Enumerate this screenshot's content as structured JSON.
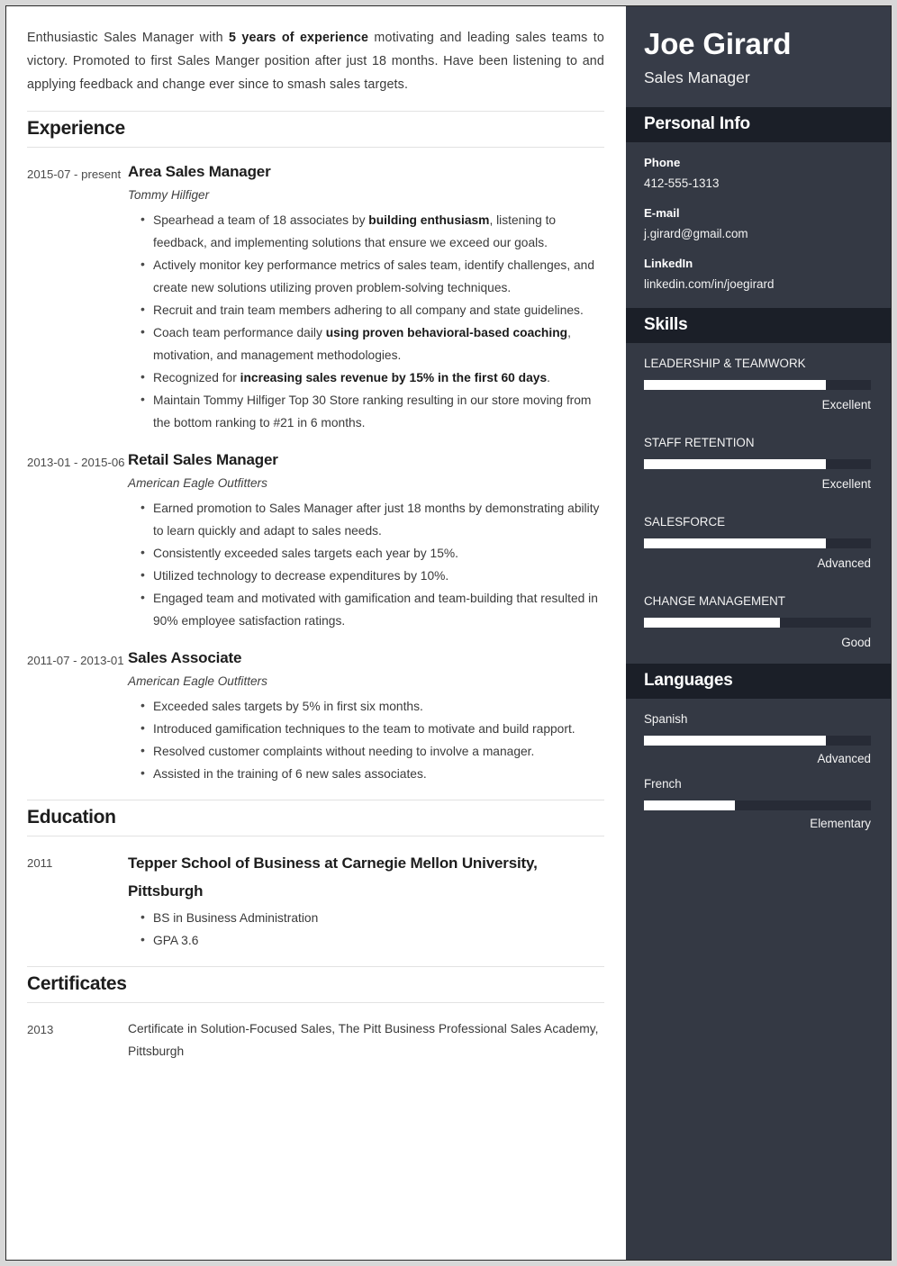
{
  "colors": {
    "sidebar_bg": "#343944",
    "sidebar_hero_bg": "#373c48",
    "section_header_bg": "#1b1f28",
    "bar_track": "#272b36",
    "bar_fill": "#ffffff",
    "page_bg": "#d8d8d8"
  },
  "summary": {
    "before_bold": "Enthusiastic Sales Manager with ",
    "bold": "5 years of experience",
    "after_bold": " motivating and leading sales teams to victory. Promoted to first Sales Manger position after just 18 months. Have been listening to and applying feedback and change ever since to smash sales targets."
  },
  "sections": {
    "experience": "Experience",
    "education": "Education",
    "certificates": "Certificates"
  },
  "experience": [
    {
      "date": "2015-07 - present",
      "title": "Area Sales Manager",
      "org": "Tommy Hilfiger",
      "bullets": [
        {
          "parts": [
            {
              "t": "Spearhead a team of 18 associates by ",
              "b": false
            },
            {
              "t": "building enthusiasm",
              "b": true
            },
            {
              "t": ", listening to feedback, and implementing solutions that ensure we exceed our goals.",
              "b": false
            }
          ]
        },
        {
          "parts": [
            {
              "t": "Actively monitor key performance metrics of sales team, identify challenges, and create new solutions utilizing proven problem-solving techniques.",
              "b": false
            }
          ]
        },
        {
          "parts": [
            {
              "t": "Recruit and train team members adhering to all company and state guidelines.",
              "b": false
            }
          ]
        },
        {
          "parts": [
            {
              "t": "Coach team performance daily ",
              "b": false
            },
            {
              "t": "using proven behavioral-based coaching",
              "b": true
            },
            {
              "t": ", motivation, and management methodologies.",
              "b": false
            }
          ]
        },
        {
          "parts": [
            {
              "t": "Recognized for ",
              "b": false
            },
            {
              "t": "increasing sales revenue by 15% in the first 60 days",
              "b": true
            },
            {
              "t": ".",
              "b": false
            }
          ]
        },
        {
          "parts": [
            {
              "t": "Maintain Tommy Hilfiger Top 30 Store ranking resulting in our store moving from the bottom ranking to #21 in 6 months.",
              "b": false
            }
          ]
        }
      ]
    },
    {
      "date": "2013-01 - 2015-06",
      "title": "Retail Sales Manager",
      "org": "American Eagle Outfitters",
      "bullets": [
        {
          "parts": [
            {
              "t": "Earned promotion to Sales Manager after just 18 months by demonstrating ability to learn quickly and adapt to sales needs.",
              "b": false
            }
          ]
        },
        {
          "parts": [
            {
              "t": "Consistently exceeded sales targets each year by 15%.",
              "b": false
            }
          ]
        },
        {
          "parts": [
            {
              "t": "Utilized technology to decrease expenditures by 10%.",
              "b": false
            }
          ]
        },
        {
          "parts": [
            {
              "t": "Engaged team and motivated with gamification and team-building that resulted in 90% employee satisfaction ratings.",
              "b": false
            }
          ]
        }
      ]
    },
    {
      "date": "2011-07 - 2013-01",
      "title": "Sales Associate",
      "org": "American Eagle Outfitters",
      "bullets": [
        {
          "parts": [
            {
              "t": "Exceeded sales targets by 5% in first six months.",
              "b": false
            }
          ]
        },
        {
          "parts": [
            {
              "t": "Introduced gamification techniques to the team to motivate and build rapport.",
              "b": false
            }
          ]
        },
        {
          "parts": [
            {
              "t": "Resolved customer complaints without needing to involve a manager.",
              "b": false
            }
          ]
        },
        {
          "parts": [
            {
              "t": "Assisted in the training of 6 new sales associates.",
              "b": false
            }
          ]
        }
      ]
    }
  ],
  "education": [
    {
      "date": "2011",
      "title": "Tepper School of Business at Carnegie Mellon University, Pittsburgh",
      "bullets": [
        "BS in Business Administration",
        "GPA 3.6"
      ]
    }
  ],
  "certificates": [
    {
      "date": "2013",
      "text": "Certificate in Solution-Focused Sales, The Pitt Business Professional Sales Academy, Pittsburgh"
    }
  ],
  "sidebar": {
    "name": "Joe Girard",
    "role": "Sales Manager",
    "personal_info_heading": "Personal Info",
    "skills_heading": "Skills",
    "languages_heading": "Languages",
    "contacts": [
      {
        "label": "Phone",
        "value": "412-555-1313"
      },
      {
        "label": "E-mail",
        "value": "j.girard@gmail.com"
      },
      {
        "label": "LinkedIn",
        "value": "linkedin.com/in/joegirard"
      }
    ],
    "skills": [
      {
        "name": "LEADERSHIP & TEAMWORK",
        "level": "Excellent",
        "percent": 80
      },
      {
        "name": "STAFF RETENTION",
        "level": "Excellent",
        "percent": 80
      },
      {
        "name": "SALESFORCE",
        "level": "Advanced",
        "percent": 80
      },
      {
        "name": "CHANGE MANAGEMENT",
        "level": "Good",
        "percent": 60
      }
    ],
    "languages": [
      {
        "name": "Spanish",
        "level": "Advanced",
        "percent": 80
      },
      {
        "name": "French",
        "level": "Elementary",
        "percent": 40
      }
    ]
  }
}
